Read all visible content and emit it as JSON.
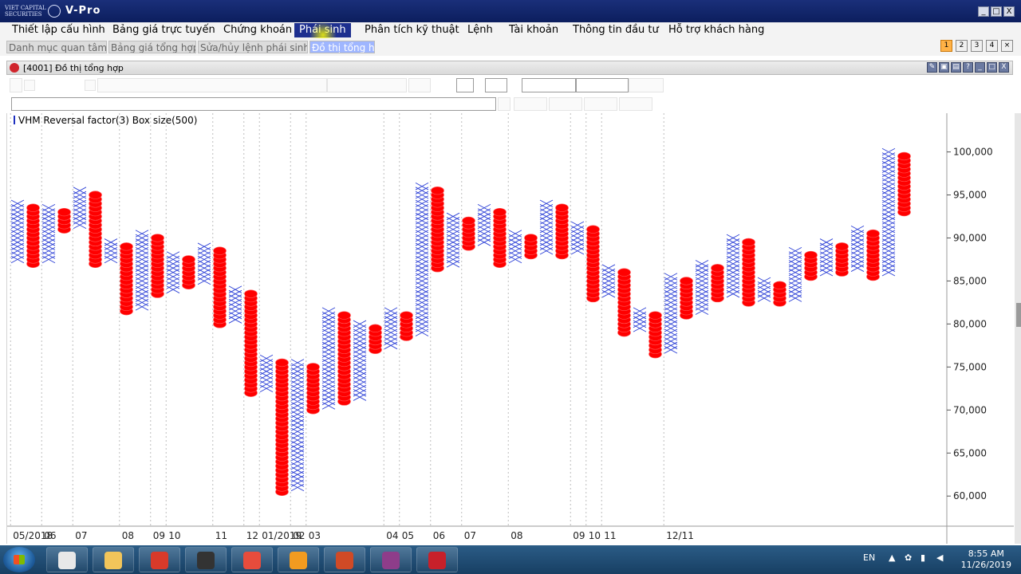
{
  "window": {
    "logo_text": "VIET CAPITAL SECURITIES",
    "title": "V-Pro",
    "controls": [
      "_",
      "□",
      "X"
    ]
  },
  "menu": [
    {
      "label": "Thiết lập cấu hình"
    },
    {
      "label": "Bảng giá trực tuyến"
    },
    {
      "label": "Chứng khoán"
    },
    {
      "label": "Phái sinh",
      "active": true
    },
    {
      "label": "Phân tích kỹ thuật"
    },
    {
      "label": "Lệnh"
    },
    {
      "label": "Tài khoản"
    },
    {
      "label": "Thông tin đầu tư"
    },
    {
      "label": "Hỗ trợ khách hàng"
    }
  ],
  "tabs": [
    {
      "label": "Danh mục quan tâm"
    },
    {
      "label": "Bảng giá tổng hợp"
    },
    {
      "label": "Sửa/hủy lệnh phái sinh"
    },
    {
      "label": "Đồ thị tổng hợp",
      "active": true
    }
  ],
  "layout_buttons": [
    "1",
    "2",
    "3",
    "4",
    "×"
  ],
  "inner_window": {
    "title": "[4001] Đồ thị tổng hợp",
    "controls": [
      "✎",
      "▣",
      "▤",
      "?",
      "_",
      "□",
      "X"
    ]
  },
  "chart_data": {
    "type": "point-and-figure",
    "symbol_caption": "VHM Reversal factor(3)  Box size(500)",
    "symbol": "VHM",
    "reversal_factor": 3,
    "box_size": 500,
    "ylim": [
      56500,
      104500
    ],
    "y_ticks": [
      {
        "value": 100000,
        "label": "100,000"
      },
      {
        "value": 95000,
        "label": "95,000"
      },
      {
        "value": 90000,
        "label": "90,000"
      },
      {
        "value": 85000,
        "label": "85,000"
      },
      {
        "value": 80000,
        "label": "80,000"
      },
      {
        "value": 75000,
        "label": "75,000"
      },
      {
        "value": 70000,
        "label": "70,000"
      },
      {
        "value": 65000,
        "label": "65,000"
      },
      {
        "value": 60000,
        "label": "60,000"
      }
    ],
    "x_labels": [
      {
        "label": "05/2018",
        "col": 0
      },
      {
        "label": "06",
        "col": 2
      },
      {
        "label": "07",
        "col": 4
      },
      {
        "label": "08",
        "col": 7
      },
      {
        "label": "09",
        "col": 9
      },
      {
        "label": "10",
        "col": 10
      },
      {
        "label": "11",
        "col": 13
      },
      {
        "label": "12",
        "col": 15
      },
      {
        "label": "01/2019",
        "col": 16
      },
      {
        "label": "02",
        "col": 18
      },
      {
        "label": "03",
        "col": 19
      },
      {
        "label": "04",
        "col": 24
      },
      {
        "label": "05",
        "col": 25
      },
      {
        "label": "06",
        "col": 27
      },
      {
        "label": "07",
        "col": 29
      },
      {
        "label": "08",
        "col": 32
      },
      {
        "label": "09",
        "col": 36
      },
      {
        "label": "10",
        "col": 37
      },
      {
        "label": "11",
        "col": 38
      },
      {
        "label": "12/11",
        "col": 42
      }
    ],
    "columns": [
      {
        "type": "X",
        "low": 87500,
        "high": 94000
      },
      {
        "type": "O",
        "low": 87000,
        "high": 93500
      },
      {
        "type": "X",
        "low": 87500,
        "high": 93500
      },
      {
        "type": "O",
        "low": 91000,
        "high": 93000
      },
      {
        "type": "X",
        "low": 91500,
        "high": 95500
      },
      {
        "type": "O",
        "low": 87000,
        "high": 95000
      },
      {
        "type": "X",
        "low": 87500,
        "high": 89500
      },
      {
        "type": "O",
        "low": 81500,
        "high": 89000
      },
      {
        "type": "X",
        "low": 82000,
        "high": 90500
      },
      {
        "type": "O",
        "low": 83500,
        "high": 90000
      },
      {
        "type": "X",
        "low": 84000,
        "high": 88000
      },
      {
        "type": "O",
        "low": 84500,
        "high": 87500
      },
      {
        "type": "X",
        "low": 85000,
        "high": 89000
      },
      {
        "type": "O",
        "low": 80000,
        "high": 88500
      },
      {
        "type": "X",
        "low": 80500,
        "high": 84000
      },
      {
        "type": "O",
        "low": 72000,
        "high": 83500
      },
      {
        "type": "X",
        "low": 72500,
        "high": 76000
      },
      {
        "type": "O",
        "low": 60500,
        "high": 75500
      },
      {
        "type": "X",
        "low": 61000,
        "high": 75500
      },
      {
        "type": "O",
        "low": 70000,
        "high": 75000
      },
      {
        "type": "X",
        "low": 70500,
        "high": 81500
      },
      {
        "type": "O",
        "low": 71000,
        "high": 81000
      },
      {
        "type": "X",
        "low": 71500,
        "high": 80000
      },
      {
        "type": "O",
        "low": 77000,
        "high": 79500
      },
      {
        "type": "X",
        "low": 77500,
        "high": 81500
      },
      {
        "type": "O",
        "low": 78500,
        "high": 81000
      },
      {
        "type": "X",
        "low": 79000,
        "high": 96000
      },
      {
        "type": "O",
        "low": 86500,
        "high": 95500
      },
      {
        "type": "X",
        "low": 87000,
        "high": 92500
      },
      {
        "type": "O",
        "low": 89000,
        "high": 92000
      },
      {
        "type": "X",
        "low": 89500,
        "high": 93500
      },
      {
        "type": "O",
        "low": 87000,
        "high": 93000
      },
      {
        "type": "X",
        "low": 87500,
        "high": 90500
      },
      {
        "type": "O",
        "low": 88000,
        "high": 90000
      },
      {
        "type": "X",
        "low": 88500,
        "high": 94000
      },
      {
        "type": "O",
        "low": 88000,
        "high": 93500
      },
      {
        "type": "X",
        "low": 88500,
        "high": 91500
      },
      {
        "type": "O",
        "low": 83000,
        "high": 91000
      },
      {
        "type": "X",
        "low": 83500,
        "high": 86500
      },
      {
        "type": "O",
        "low": 79000,
        "high": 86000
      },
      {
        "type": "X",
        "low": 79500,
        "high": 81500
      },
      {
        "type": "O",
        "low": 76500,
        "high": 81000
      },
      {
        "type": "X",
        "low": 77000,
        "high": 85500
      },
      {
        "type": "O",
        "low": 81000,
        "high": 85000
      },
      {
        "type": "X",
        "low": 81500,
        "high": 87000
      },
      {
        "type": "O",
        "low": 83000,
        "high": 86500
      },
      {
        "type": "X",
        "low": 83500,
        "high": 90000
      },
      {
        "type": "O",
        "low": 82500,
        "high": 89500
      },
      {
        "type": "X",
        "low": 83000,
        "high": 85000
      },
      {
        "type": "O",
        "low": 82500,
        "high": 84500
      },
      {
        "type": "X",
        "low": 83000,
        "high": 88500
      },
      {
        "type": "O",
        "low": 85500,
        "high": 88000
      },
      {
        "type": "X",
        "low": 86000,
        "high": 89500
      },
      {
        "type": "O",
        "low": 86000,
        "high": 89000
      },
      {
        "type": "X",
        "low": 86500,
        "high": 91000
      },
      {
        "type": "O",
        "low": 85500,
        "high": 90500
      },
      {
        "type": "X",
        "low": 86000,
        "high": 100000
      },
      {
        "type": "O",
        "low": 93000,
        "high": 99500
      }
    ],
    "colors": {
      "X": "#2b3fd6",
      "O": "#ff0000",
      "grid": "#bdbdbd"
    }
  },
  "taskbar": {
    "apps": [
      {
        "name": "network-app",
        "color": "#e8e8e8"
      },
      {
        "name": "file-explorer",
        "color": "#f2c55a"
      },
      {
        "name": "stock-app",
        "color": "#d83a2a"
      },
      {
        "name": "film-app",
        "color": "#333333"
      },
      {
        "name": "chrome",
        "color": "#e74c3c"
      },
      {
        "name": "media-player",
        "color": "#f29b20"
      },
      {
        "name": "powerpoint",
        "color": "#d04a26"
      },
      {
        "name": "winrar",
        "color": "#8e3d8a"
      },
      {
        "name": "vpro-app",
        "color": "#c8202a"
      }
    ],
    "language": "EN",
    "time": "8:55 AM",
    "date": "11/26/2019"
  }
}
